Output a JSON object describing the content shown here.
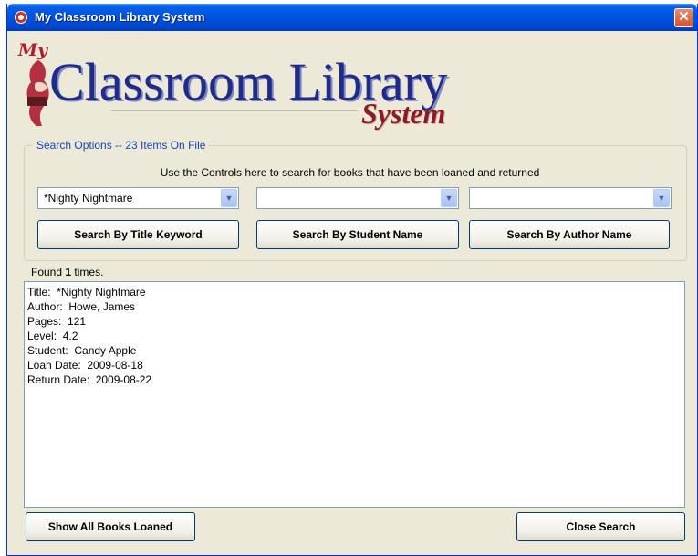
{
  "window": {
    "title": "My Classroom Library System",
    "close_glyph": "✕"
  },
  "logo": {
    "my": "My",
    "main": "Classroom Library",
    "sub": "System"
  },
  "search_options": {
    "legend": "Search Options  --  23 Items On File",
    "instruction": "Use the Controls here to search for books that have been loaned and returned",
    "title_combo": {
      "value": "*Nighty Nightmare"
    },
    "student_combo": {
      "value": ""
    },
    "author_combo": {
      "value": ""
    },
    "buttons": {
      "title": "Search By Title Keyword",
      "student": "Search By Student Name",
      "author": "Search By Author Name"
    }
  },
  "results": {
    "found_prefix": "Found",
    "found_count": "1",
    "found_suffix": "times.",
    "lines": [
      "Title:  *Nighty Nightmare",
      "Author:  Howe, James",
      "Pages:  121",
      "Level:  4.2",
      "Student:  Candy Apple",
      "Loan Date:  2009-08-18",
      "Return Date:  2009-08-22"
    ]
  },
  "footer": {
    "show_all": "Show All Books Loaned",
    "close": "Close Search"
  },
  "icons": {
    "app": "heart-icon",
    "dropdown": "chevron-down-icon"
  },
  "colors": {
    "titlebar": "#0054e3",
    "window_bg": "#ece9d8",
    "logo_blue": "#1f2b86",
    "logo_red": "#8b1c24",
    "legend_blue": "#1746b8"
  }
}
